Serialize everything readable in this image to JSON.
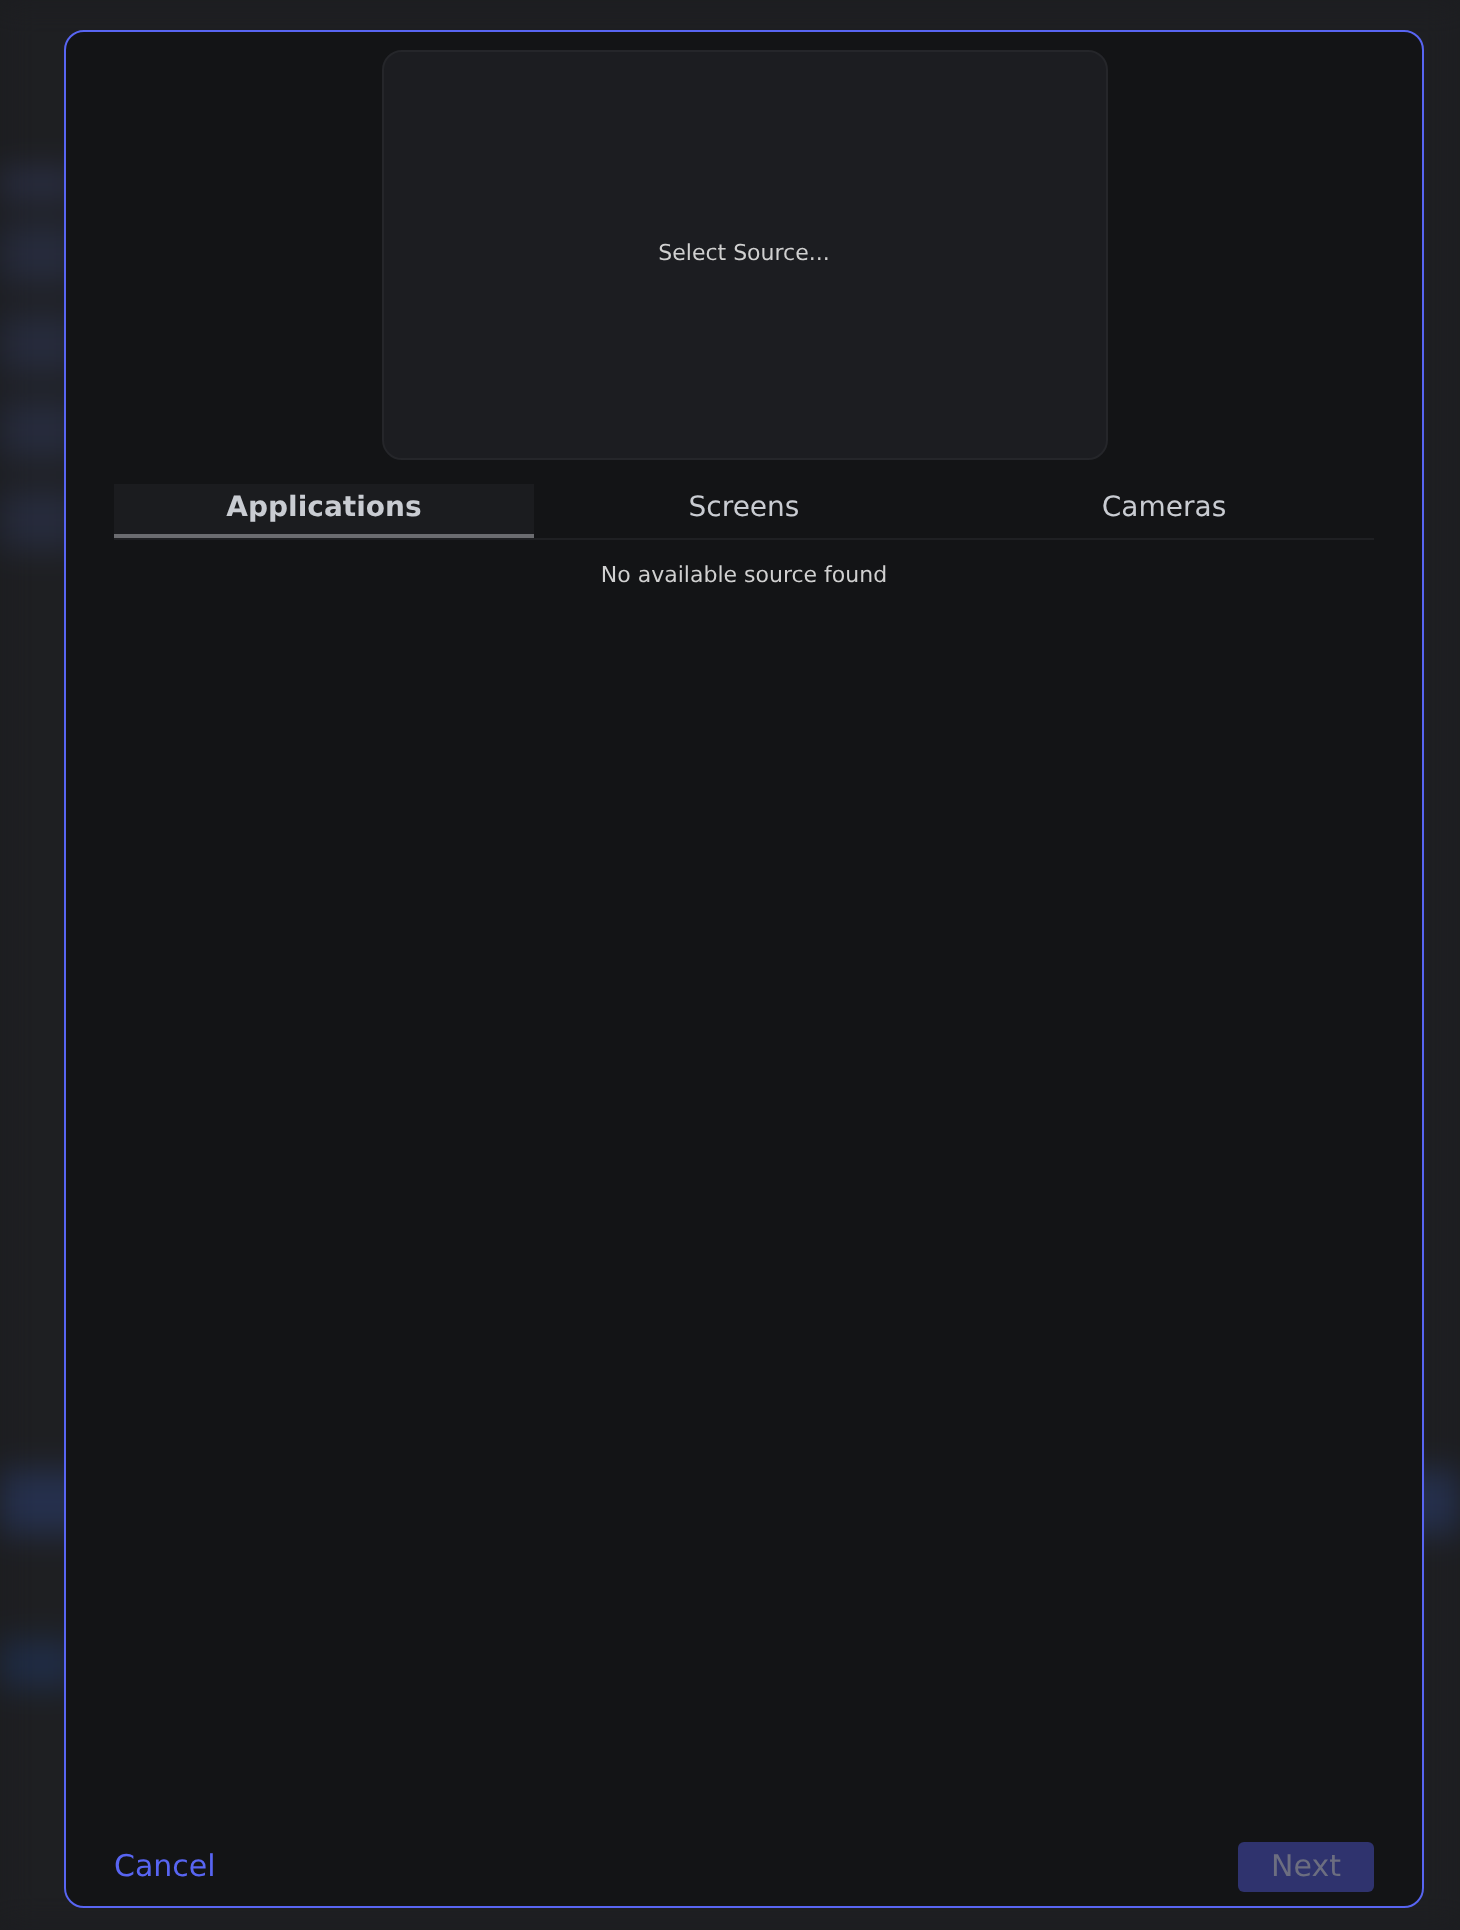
{
  "preview": {
    "label": "Select Source..."
  },
  "tabs": [
    {
      "label": "Applications",
      "selected": true
    },
    {
      "label": "Screens",
      "selected": false
    },
    {
      "label": "Cameras",
      "selected": false
    }
  ],
  "empty_message": "No available source found",
  "footer": {
    "cancel": {
      "label": "Cancel"
    },
    "next": {
      "label": "Next",
      "disabled": true
    }
  }
}
